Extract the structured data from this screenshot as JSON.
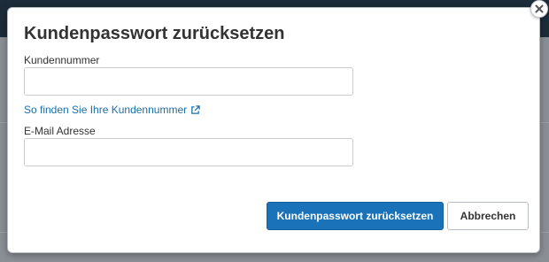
{
  "dialog": {
    "title": "Kundenpasswort zurücksetzen",
    "customer_number": {
      "label": "Kundennummer",
      "value": "",
      "placeholder": ""
    },
    "help_link": {
      "label": "So finden Sie Ihre Kundennummer",
      "icon": "external-link-icon"
    },
    "email": {
      "label": "E-Mail Adresse",
      "value": "",
      "placeholder": ""
    },
    "buttons": {
      "submit_label": "Kundenpasswort zurücksetzen",
      "cancel_label": "Abbrechen"
    },
    "close_icon": "close-icon"
  },
  "colors": {
    "primary": "#1a72b8",
    "link": "#1a6fa8",
    "text": "#333333"
  }
}
